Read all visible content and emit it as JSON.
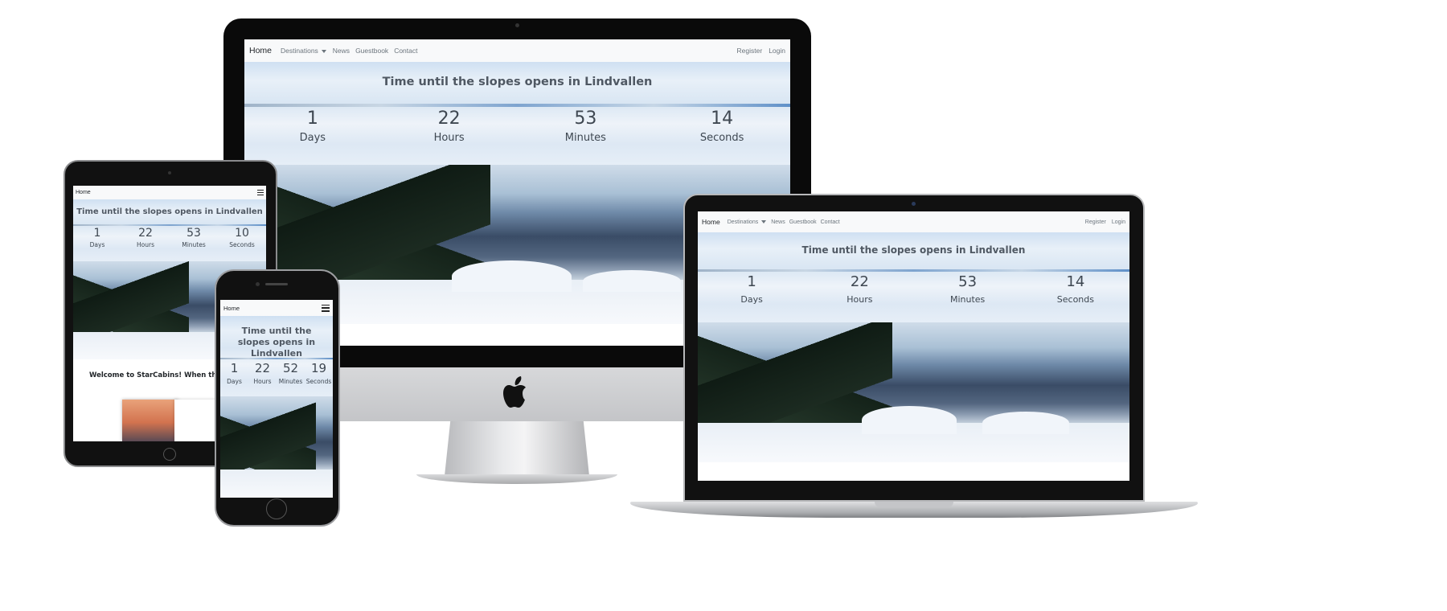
{
  "site": {
    "brand": "Home",
    "nav_links": [
      "Destinations",
      "News",
      "Guestbook",
      "Contact"
    ],
    "nav_right": [
      "Register",
      "Login"
    ],
    "countdown_title": "Time until the slopes opens in Lindvallen",
    "units": [
      "Days",
      "Hours",
      "Minutes",
      "Seconds"
    ],
    "welcome_text": "Welcome to StarCabins! When the Cabin"
  },
  "devices": {
    "imac": {
      "values": [
        "1",
        "22",
        "53",
        "14"
      ]
    },
    "laptop": {
      "values": [
        "1",
        "22",
        "53",
        "14"
      ]
    },
    "tablet": {
      "values": [
        "1",
        "22",
        "53",
        "10"
      ]
    },
    "phone": {
      "values": [
        "1",
        "22",
        "52",
        "19"
      ]
    }
  },
  "icons": {
    "menu": "hamburger-menu-icon",
    "dropdown": "caret-down-icon",
    "logo": "apple-logo-icon"
  },
  "colors": {
    "navbar_bg": "#f8f9fa",
    "brand_text": "#212529",
    "nav_link_text": "#6c757d",
    "countdown_text": "#3e4751",
    "title_text": "#4f5863"
  }
}
